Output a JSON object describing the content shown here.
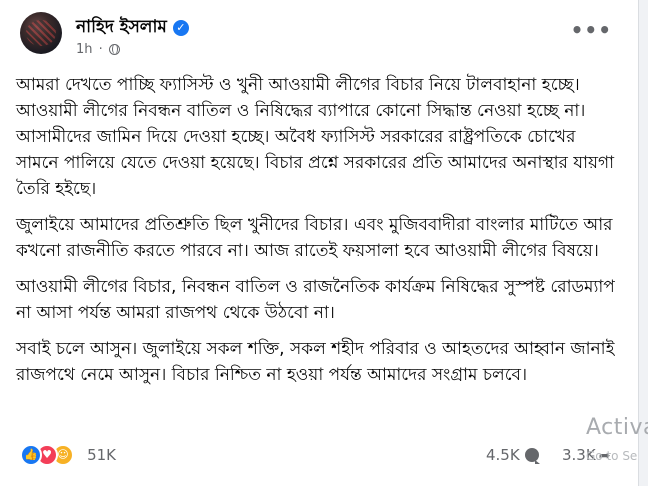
{
  "post": {
    "author": "নাহিদ ইসলাম",
    "verified_icon": "verified-badge-icon",
    "time": "1h",
    "privacy_icon": "globe-icon",
    "more_label": "•••",
    "paragraphs": [
      "আমরা দেখতে পাচ্ছি ফ্যাসিস্ট ও খুনী আওয়ামী লীগের বিচার নিয়ে টালবাহানা হচ্ছে।আওয়ামী লীগের নিবন্ধন বাতিল ও নিষিদ্ধের ব্যাপারে কোনো সিদ্ধান্ত নেওয়া হচ্ছে না। আসামীদের জামিন দিয়ে দেওয়া হচ্ছে। অবৈধ ফ্যাসিস্ট সরকারের রাষ্ট্রপতিকে চোখের সামনে পালিয়ে যেতে দেওয়া হয়েছে। বিচার প্রশ্নে সরকারের প্রতি আমাদের অনাস্থার যায়গা তৈরি হইছে।",
      "জুলাইয়ে আমাদের প্রতিশ্রুতি ছিল খুনীদের বিচার। এবং মুজিববাদীরা বাংলার মাটিতে আর কখনো রাজনীতি করতে পারবে না। আজ রাতেই ফয়সালা হবে আওয়ামী লীগের বিষয়ে।",
      "আওয়ামী লীগের বিচার, নিবন্ধন বাতিল ও রাজনৈতিক কার্যক্রম নিষিদ্ধের সুস্পষ্ট রোডম্যাপ না আসা পর্যন্ত আমরা রাজপথ থেকে উঠবো না।",
      "সবাই চলে আসুন। জুলাইয়ে সকল শক্তি, সকল শহীদ পরিবার ও আহতদের আহ্বান জানাই রাজপথে নেমে আসুন। বিচার নিশ্চিত না হওয়া পর্যন্ত আমাদের সংগ্রাম চলবে।"
    ]
  },
  "stats": {
    "reactions_count": "51K",
    "reaction_icons": [
      "like-icon",
      "love-icon",
      "care-icon"
    ],
    "comments_count": "4.5K",
    "shares_count": "3.3K"
  },
  "overlay": {
    "activate_text": "Activa",
    "activate_sub": "Go to Se"
  },
  "colors": {
    "accent": "#1877f2",
    "love": "#f33e58",
    "care": "#f7b125",
    "text": "#050505",
    "muted": "#65676b"
  }
}
